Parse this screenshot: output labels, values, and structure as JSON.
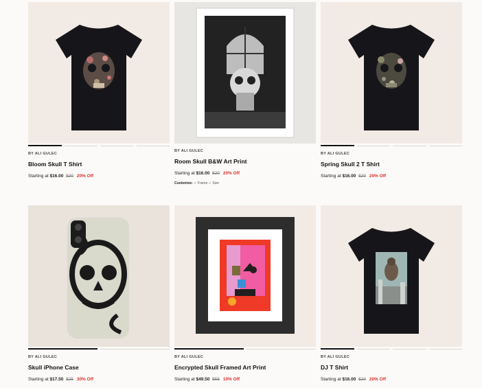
{
  "products": [
    {
      "by": "BY ALI GULEC",
      "title": "Bloom Skull T Shirt",
      "starting": "Starting at",
      "price": "$16.00",
      "was": "$20",
      "off": "20% Off"
    },
    {
      "by": "BY ALI GULEC",
      "title": "Room Skull B&W Art Print",
      "starting": "Starting at",
      "price": "$16.00",
      "was": "$20",
      "off": "20% Off",
      "customize_label": "Customize:",
      "customize_opts": "✓ Frame  ✓ Size"
    },
    {
      "by": "BY ALI GULEC",
      "title": "Spring Skull 2 T Shirt",
      "starting": "Starting at",
      "price": "$16.00",
      "was": "$20",
      "off": "20% Off"
    },
    {
      "by": "BY ALI GULEC",
      "title": "Skull iPhone Case",
      "starting": "Starting at",
      "price": "$17.50",
      "was": "$25",
      "off": "30% Off"
    },
    {
      "by": "BY ALI GULEC",
      "title": "Encrypted Skull Framed Art Print",
      "starting": "Starting at",
      "price": "$49.50",
      "was": "$55",
      "off": "10% Off"
    },
    {
      "by": "BY ALI GULEC",
      "title": "DJ T Shirt",
      "starting": "Starting at",
      "price": "$16.00",
      "was": "$20",
      "off": "20% Off"
    }
  ],
  "colors": {
    "sale": "#d8322a",
    "tile_bg": "#f2ebe5",
    "shirt": "#16161a"
  }
}
